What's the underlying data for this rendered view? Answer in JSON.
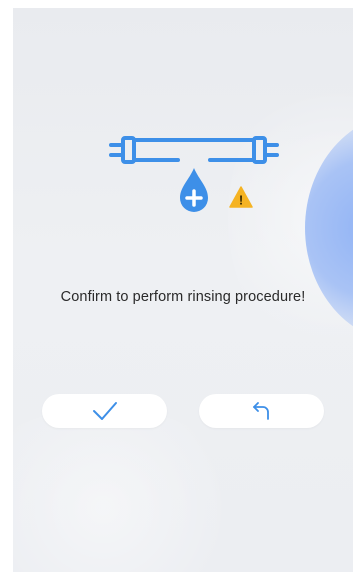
{
  "dialog": {
    "message": "Confirm to perform rinsing procedure!"
  },
  "buttons": {
    "confirm_icon": "check-icon",
    "back_icon": "undo-arrow-icon"
  },
  "illustration": {
    "icon": "water-pipe-rinse-icon",
    "badge_icon": "warning-icon",
    "badge_symbol": "!"
  },
  "colors": {
    "primary": "#3d8fe8",
    "warning": "#f5b323",
    "button_bg": "#ffffff",
    "text": "#2a2a2a"
  }
}
